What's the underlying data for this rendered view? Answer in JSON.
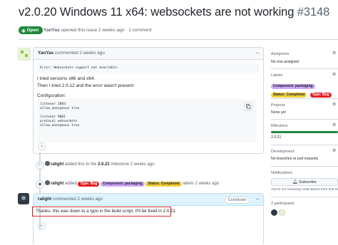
{
  "issue": {
    "title": "v2.0.20 Windows 11 x64: websockets are not working",
    "number": "#3148",
    "state": "Open",
    "author": "YanYas",
    "meta_text": "opened this issue 2 weeks ago · 1 comment"
  },
  "comment1": {
    "author": "YanYas",
    "when": "commented 2 weeks ago",
    "code_error": "Error: Websockets support not available.",
    "line1": "I tried versions x86 and x64.",
    "line2": "Then I tried 2.0.12 and the error wasn't present",
    "line3": "Configuration:",
    "config": [
      "listener 1883",
      "allow_anonymous true",
      "",
      "listener 9001",
      "protocol websockets",
      "allow_anonymous true"
    ]
  },
  "events": {
    "e1_actor": "ralight",
    "e1_text": "added this to the",
    "e1_milestone": "2.0.21",
    "e1_tail": "milestone 2 weeks ago",
    "e2_actor": "ralight",
    "e2_text": "added",
    "e2_tail": "labels 2 weeks ago"
  },
  "labels": {
    "typo": "Type: Bug",
    "component": "Component: packaging",
    "status": "Status: Completed"
  },
  "comment2": {
    "author": "ralight",
    "when": "commented 2 weeks ago",
    "role": "Contributor",
    "body": "Thanks, this was down to a typo in the build script. It'll be fixed in 2.0.21."
  },
  "sidebar": {
    "assignees_h": "Assignees",
    "assignees_v": "No one assigned",
    "labels_h": "Labels",
    "projects_h": "Projects",
    "projects_v": "None yet",
    "milestone_h": "Milestone",
    "milestone_v": "2.0.21",
    "development_h": "Development",
    "development_v": "No branches or pull requests",
    "notifications_h": "Notifications",
    "subscribe": "Subscribe",
    "notif_note": "You're not receiving notifications from this thread.",
    "participants_h": "2 participants"
  },
  "colors": {
    "open_green": "#1f883d",
    "label_bug": "#e11d21",
    "label_packaging": "#c9a6f5",
    "label_completed": "#f0d03b",
    "highlight_box": "#d72b2b"
  }
}
